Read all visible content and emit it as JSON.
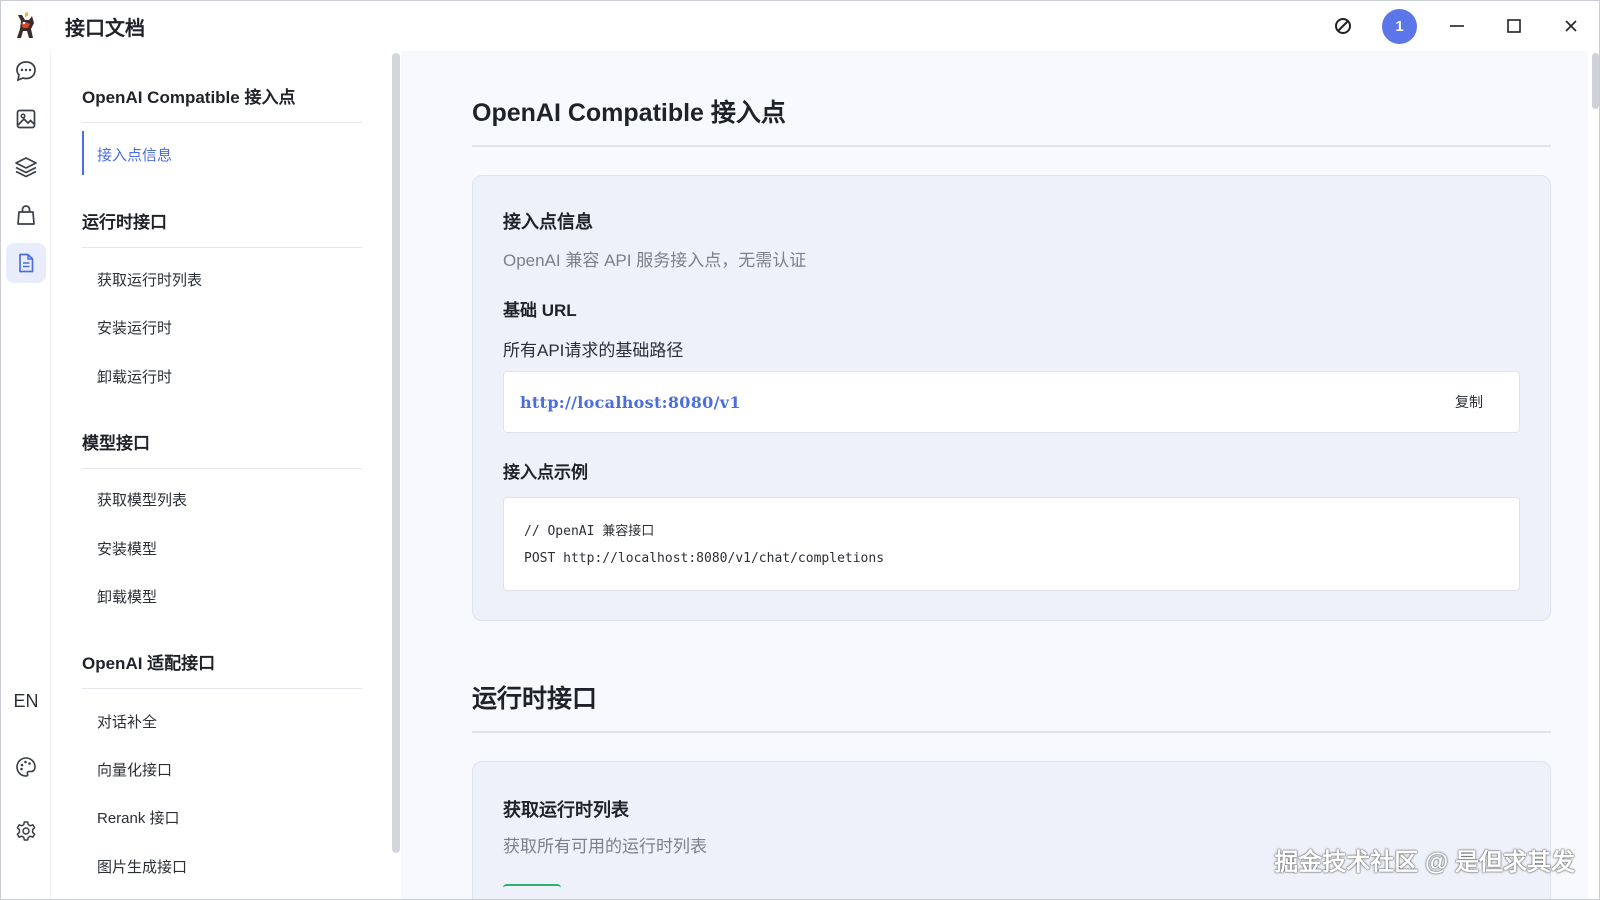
{
  "window": {
    "title": "接口文档",
    "badge_count": "1",
    "watermark": "掘金技术社区 @ 是但求其发"
  },
  "rail": {
    "lang": "EN",
    "items": [
      "chat-icon",
      "image-icon",
      "layers-icon",
      "bag-icon",
      "document-icon"
    ],
    "bottom_items": [
      "palette-icon",
      "gear-icon"
    ]
  },
  "nav": {
    "groups": [
      {
        "heading": "OpenAI Compatible 接入点",
        "items": [
          "接入点信息"
        ]
      },
      {
        "heading": "运行时接口",
        "items": [
          "获取运行时列表",
          "安装运行时",
          "卸载运行时"
        ]
      },
      {
        "heading": "模型接口",
        "items": [
          "获取模型列表",
          "安装模型",
          "卸载模型"
        ]
      },
      {
        "heading": "OpenAI 适配接口",
        "items": [
          "对话补全",
          "向量化接口",
          "Rerank 接口",
          "图片生成接口"
        ]
      }
    ]
  },
  "main": {
    "sections": [
      {
        "title": "OpenAI Compatible 接入点",
        "card": {
          "title": "接入点信息",
          "desc": "OpenAI 兼容 API 服务接入点，无需认证",
          "base_url_title": "基础 URL",
          "base_url_desc": "所有API请求的基础路径",
          "base_url": "http://localhost:8080/v1",
          "copy_label": "复制",
          "example_title": "接入点示例",
          "example_line1": "// OpenAI 兼容接口",
          "example_line2": "POST http://localhost:8080/v1/chat/completions"
        }
      },
      {
        "title": "运行时接口",
        "card": {
          "title": "获取运行时列表",
          "desc": "获取所有可用的运行时列表"
        }
      }
    ]
  },
  "colors": {
    "accent": "#4a6ee0",
    "badge": "#5b76e8",
    "card_bg": "#eef1fa"
  }
}
